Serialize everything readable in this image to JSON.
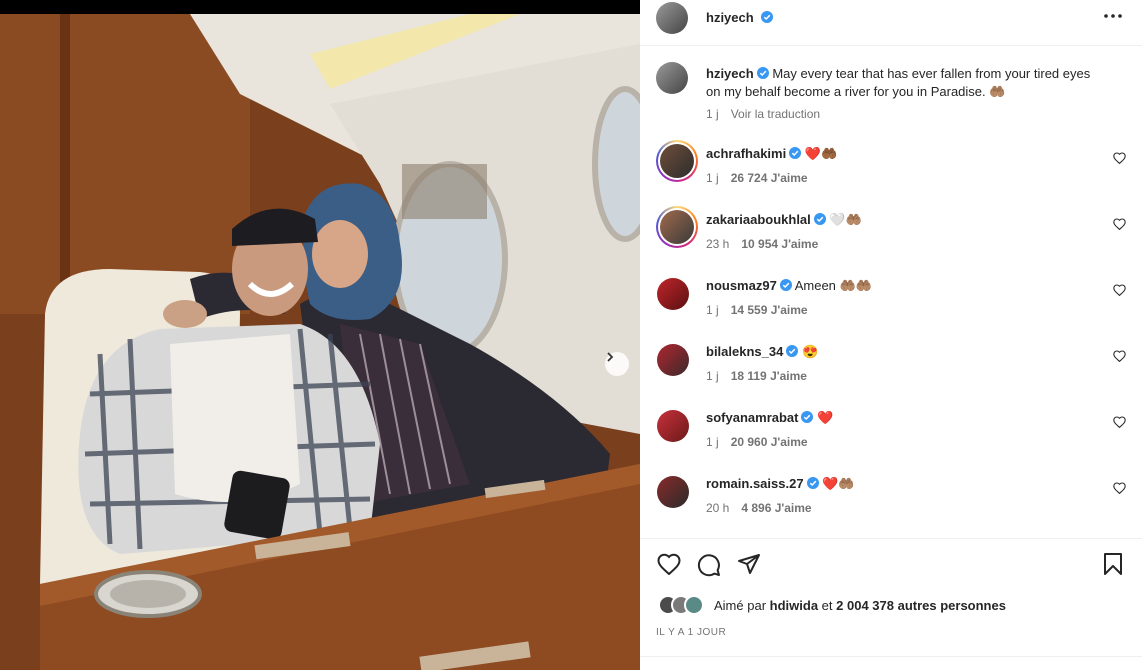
{
  "post": {
    "author": "hziyech",
    "caption": "May every tear that has ever fallen from your tired eyes on my behalf become a river for you in Paradise. 🤲🏽",
    "caption_age": "1 j",
    "translate_label": "Voir la traduction"
  },
  "comments": [
    {
      "user": "achrafhakimi",
      "text": "❤️🤲🏾",
      "age": "1 j",
      "likes": "26 724 J'aime"
    },
    {
      "user": "zakariaaboukhlal",
      "text": "🤍🤲🏽",
      "age": "23 h",
      "likes": "10 954 J'aime"
    },
    {
      "user": "nousmaz97",
      "text": "Ameen 🤲🏽🤲🏽",
      "age": "1 j",
      "likes": "14 559 J'aime"
    },
    {
      "user": "bilalekns_34",
      "text": "😍",
      "age": "1 j",
      "likes": "18 119 J'aime"
    },
    {
      "user": "sofyanamrabat",
      "text": "❤️",
      "age": "1 j",
      "likes": "20 960 J'aime"
    },
    {
      "user": "romain.saiss.27",
      "text": "❤️🤲🏽",
      "age": "20 h",
      "likes": "4 896 J'aime"
    }
  ],
  "likes_line": {
    "prefix": "Aimé par",
    "user": "hdiwida",
    "conj": "et",
    "count": "2 004 378 autres personnes"
  },
  "time_ago": "IL Y A 1 JOUR",
  "icons": {
    "verified": "verified-badge-icon",
    "more": "more-options-icon",
    "heart": "heart-outline-icon",
    "comment": "comment-bubble-icon",
    "share": "share-paper-plane-icon",
    "save": "bookmark-icon",
    "next": "chevron-right-icon"
  },
  "colors": {
    "verified_blue": "#3897f0",
    "text": "#262626",
    "muted": "#737373"
  }
}
